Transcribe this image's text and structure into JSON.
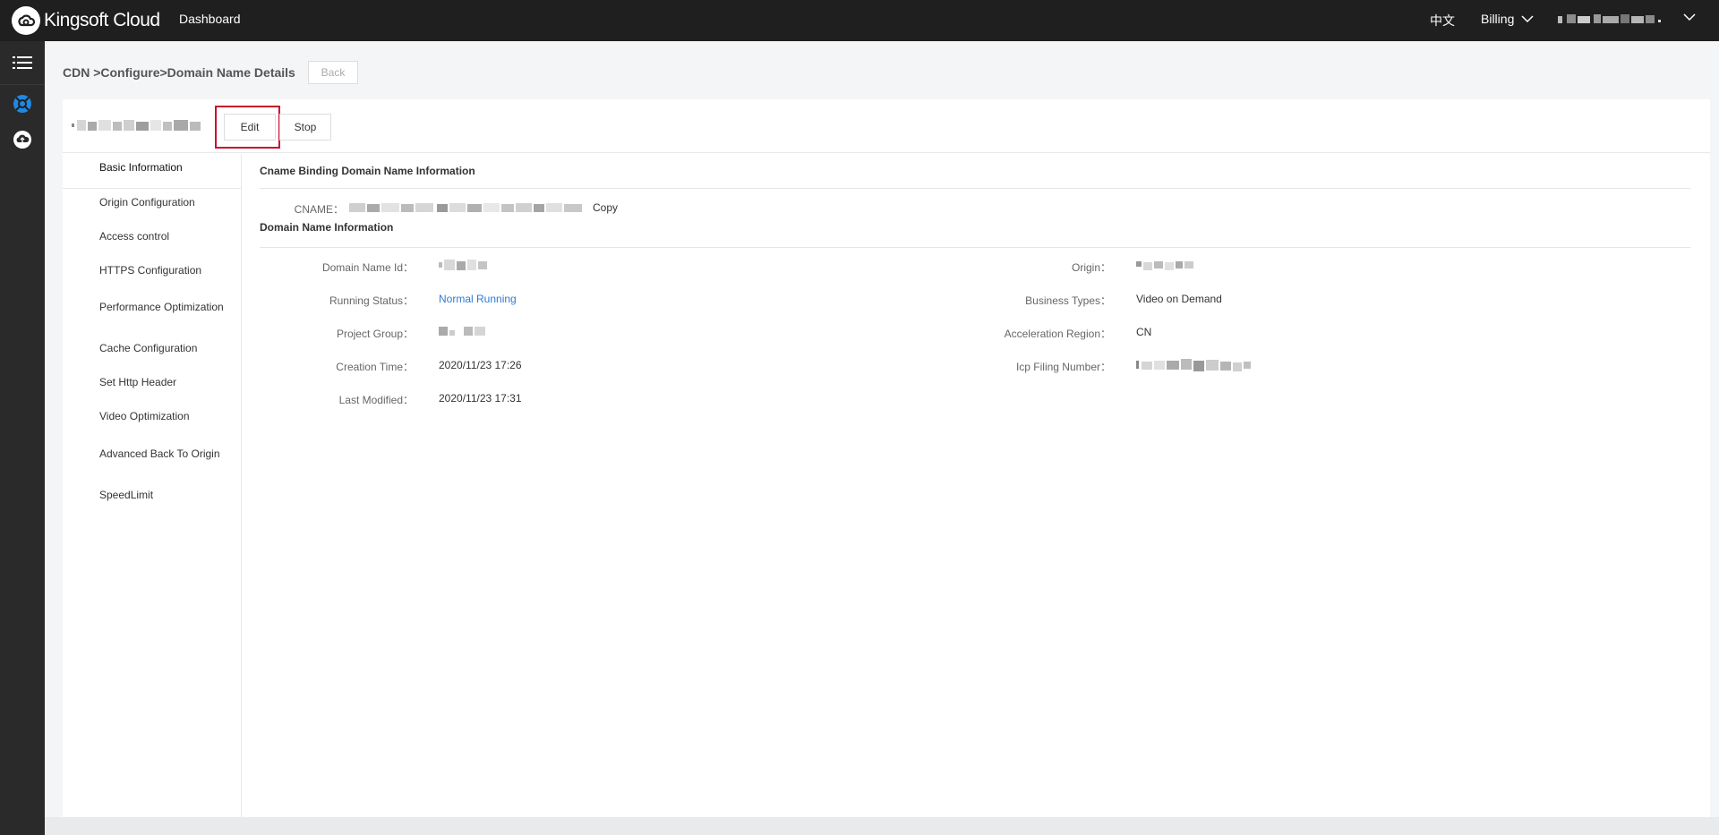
{
  "header": {
    "brand": "Kingsoft Cloud",
    "dashboard_label": "Dashboard",
    "language_label": "中文",
    "billing_label": "Billing"
  },
  "rail": {
    "items": [
      {
        "icon": "menu-list-icon"
      },
      {
        "icon": "cdn-icon"
      },
      {
        "icon": "cloud-upload-icon"
      }
    ]
  },
  "page": {
    "breadcrumb": "CDN >Configure>Domain Name Details",
    "back_label": "Back",
    "edit_label": "Edit",
    "stop_label": "Stop"
  },
  "sidenav": {
    "items": [
      "Basic Information",
      "Origin Configuration",
      "Access control",
      "HTTPS Configuration",
      "Performance Optimization",
      "Cache Configuration",
      "Set Http Header",
      "Video Optimization",
      "Advanced Back To Origin",
      "SpeedLimit"
    ],
    "active_index": 0
  },
  "cname_section": {
    "title": "Cname Binding Domain Name Information",
    "cname_label": "CNAME：",
    "copy_label": "Copy"
  },
  "domain_section": {
    "title": "Domain Name Information",
    "left": [
      {
        "label": "Domain Name Id：",
        "value": ""
      },
      {
        "label": "Running Status：",
        "value": "Normal Running"
      },
      {
        "label": "Project Group：",
        "value": ""
      },
      {
        "label": "Creation Time：",
        "value": "2020/11/23 17:26"
      },
      {
        "label": "Last Modified：",
        "value": "2020/11/23 17:31"
      }
    ],
    "right": [
      {
        "label": "Origin：",
        "value": ""
      },
      {
        "label": "Business Types：",
        "value": "Video on Demand"
      },
      {
        "label": "Acceleration Region：",
        "value": "CN"
      },
      {
        "label": "Icp Filing Number：",
        "value": ""
      }
    ]
  },
  "colors": {
    "topbar": "#1f1f1f",
    "rail": "#2a2a2a",
    "link": "#2f7bd3",
    "highlight": "#c8102e",
    "active_icon": "#1e88e5"
  }
}
